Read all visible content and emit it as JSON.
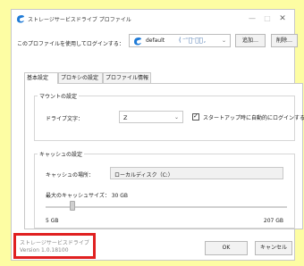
{
  "window": {
    "title": "ストレージサービスドライブ プロファイル",
    "controls": {
      "minimize": "—",
      "maximize": "□",
      "close": "✕"
    }
  },
  "profile": {
    "label": "このプロファイルを使用してログインする：",
    "selected_value": "default",
    "selected_extra": "(  ⁻⁼ﾞ⁻ﾞﾞ  ,  ",
    "add_button": "追加…",
    "delete_button": "削除…"
  },
  "tabs": [
    {
      "label": "基本設定",
      "active": true
    },
    {
      "label": "プロキシの設定",
      "active": false
    },
    {
      "label": "プロファイル情報",
      "active": false
    }
  ],
  "mount": {
    "title": "マウントの設定",
    "drive_label": "ドライブ文字：",
    "drive_value": "Z",
    "autologin_checked": true,
    "autologin_label": "スタートアップ時に自動的にログインする"
  },
  "cache": {
    "title": "キャッシュの設定",
    "location_label": "キャッシュの場所：",
    "location_value": "ローカルディスク（C:）",
    "size_label": "最大のキャッシュサイズ：  30 GB",
    "slider_min_label": "5 GB",
    "slider_max_label": "207 GB",
    "slider_level": 0.11
  },
  "footer": {
    "app_name": "ストレージサービスドライブ",
    "version": "Version 1.0.18100",
    "ok_button": "OK",
    "cancel_button": "キャンセル"
  },
  "colors": {
    "background": "#fdfda3",
    "highlight_border": "#e02020",
    "icon_blue": "#1e7ad6"
  },
  "icons": [
    "app-logo-icon",
    "profile-logo-icon",
    "chevron-down-icon",
    "check-icon"
  ]
}
